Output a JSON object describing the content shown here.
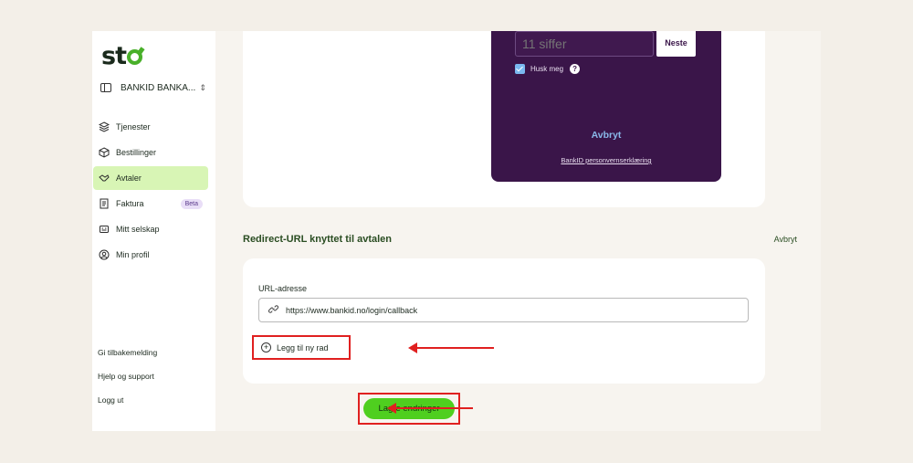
{
  "brand": {
    "logo_text": "st",
    "accent": "#49b02a"
  },
  "sidebar": {
    "org_name": "BANKID BANKA...",
    "items": [
      {
        "label": "Tjenester",
        "icon": "layers-icon"
      },
      {
        "label": "Bestillinger",
        "icon": "package-icon"
      },
      {
        "label": "Avtaler",
        "icon": "handshake-icon",
        "active": true
      },
      {
        "label": "Faktura",
        "icon": "invoice-icon",
        "badge": "Beta"
      },
      {
        "label": "Mitt selskap",
        "icon": "company-icon"
      },
      {
        "label": "Min profil",
        "icon": "user-icon"
      }
    ],
    "bottom_links": [
      "Gi tilbakemelding",
      "Hjelp og support",
      "Logg ut"
    ]
  },
  "bankid": {
    "input_placeholder": "11 siffer",
    "next_label": "Neste",
    "remember_label": "Husk meg",
    "help_glyph": "?",
    "cancel_label": "Avbryt",
    "privacy_link": "BankID personvernserklæring",
    "bg_color": "#3a1549"
  },
  "redirect": {
    "title": "Redirect-URL knyttet til avtalen",
    "cancel_label": "Avbryt",
    "url_label": "URL-adresse",
    "url_value": "https://www.bankid.no/login/callback",
    "add_row_label": "Legg til ny rad"
  },
  "actions": {
    "save_label": "Lagre endringer",
    "save_color": "#4fcf1f",
    "highlight_color": "#e02020"
  }
}
